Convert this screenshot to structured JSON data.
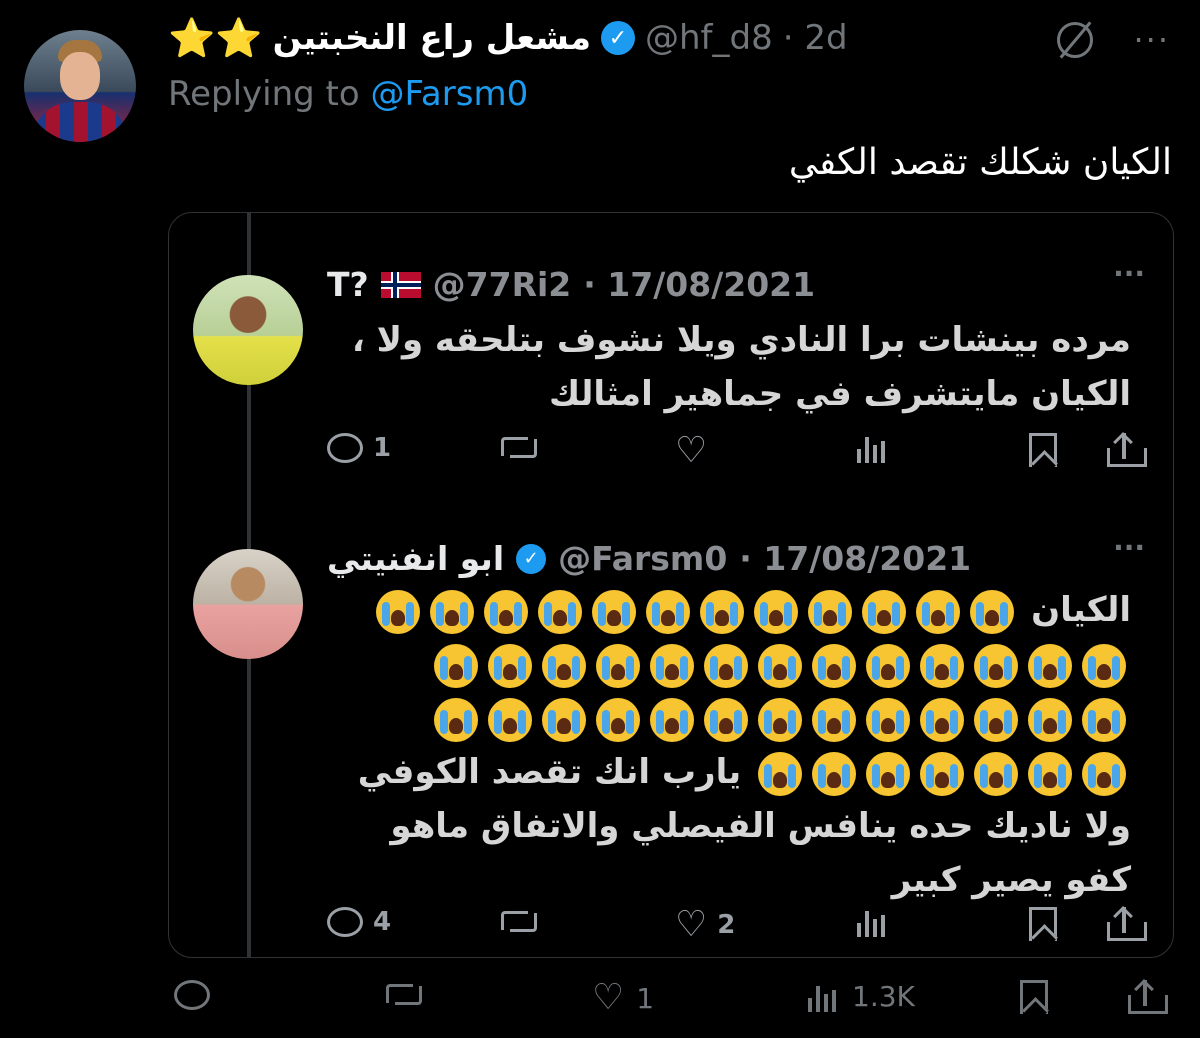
{
  "tweet": {
    "display_name": "مشعل راع النخبتين",
    "stars": "⭐⭐",
    "handle": "@hf_d8",
    "time": "· 2d",
    "replying_prefix": "Replying to",
    "replying_mention": "@Farsm0",
    "text": "الكيان شكلك تقصد الكفي",
    "footer": {
      "replies": "",
      "likes": "1",
      "views": "1.3K"
    }
  },
  "embedded": {
    "tweets": [
      {
        "display_name": "T?",
        "handle": "@77Ri2",
        "date": "· 17/08/2021",
        "lines": [
          "مرده بينشات برا النادي ويلا نشوف بتلحقه ولا ،",
          "الكيان مايتشرف في جماهير امثالك"
        ],
        "replies": "1",
        "likes": ""
      },
      {
        "display_name": "ابو انفنيتي",
        "handle": "@Farsm0",
        "date": "· 17/08/2021",
        "lines": [
          "الكيان",
          "يارب انك تقصد الكوفي",
          "ولا ناديك حده ينافس الفيصلي والاتفاق ماهو",
          "كفو يصير كبير"
        ],
        "replies": "4",
        "likes": "2"
      }
    ]
  },
  "icons": {
    "more": "···",
    "verified": "✓"
  },
  "colors": {
    "background": "#000000",
    "accent": "#1d9bf0",
    "muted": "#71767b",
    "star": "#f5c518"
  }
}
